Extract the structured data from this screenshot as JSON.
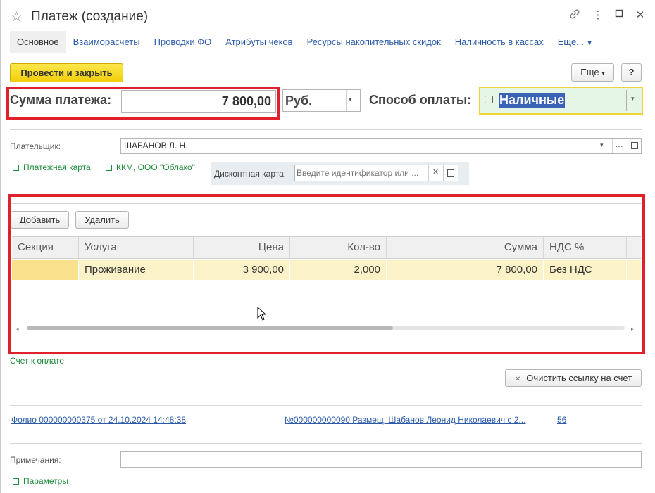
{
  "window": {
    "title": "Платеж (создание)",
    "controls": [
      "⊘",
      "⋮",
      "□",
      "✕"
    ]
  },
  "tabs": [
    {
      "label": "Основное",
      "active": true
    },
    {
      "label": "Взаиморасчеты"
    },
    {
      "label": "Проводки ФО"
    },
    {
      "label": "Атрибуты чеков"
    },
    {
      "label": "Ресурсы накопительных скидок"
    },
    {
      "label": "Наличность в кассах"
    },
    {
      "label": "Еще..."
    }
  ],
  "toolbar": {
    "post_close_label": "Провести и закрыть",
    "more_label": "Еще",
    "help_label": "?"
  },
  "payment": {
    "amount_label": "Сумма платежа:",
    "amount_value": "7 800,00",
    "currency_value": "Руб.",
    "method_label": "Способ оплаты:",
    "method_value": "Наличные"
  },
  "payer": {
    "label": "Плательщик:",
    "value": "ШАБАНОВ Л. Н."
  },
  "links": {
    "payment_card": "Платежная карта",
    "kkm": "ККМ, ООО \"Облако\"",
    "invoice": "Счет к оплате",
    "params": "Параметры"
  },
  "discount": {
    "label": "Дисконтная карта:",
    "placeholder": "Введите идентификатор или ..."
  },
  "table": {
    "add_label": "Добавить",
    "delete_label": "Удалить",
    "columns": [
      "Секция",
      "Услуга",
      "Цена",
      "Кол-во",
      "Сумма",
      "НДС %"
    ],
    "rows": [
      {
        "section": "",
        "service": "Проживание",
        "price": "3 900,00",
        "qty": "2,000",
        "sum": "7 800,00",
        "vat": "Без НДС"
      }
    ]
  },
  "invoice_clear_label": "Очистить ссылку на счет",
  "footer_links": {
    "folio": "Фолио 000000000375 от 24.10.2024 14:48:38",
    "booking": "№000000000090 Размещ. Шабанов Леонид Николаевич с 2...",
    "number": "56"
  },
  "notes": {
    "label": "Примечания:",
    "value": ""
  },
  "colors": {
    "accent_red": "#e0202a",
    "button_yellow": "#f2cf0b",
    "link_blue": "#2a5aa8",
    "link_green": "#1c8b3a",
    "row_highlight": "#fbf3c7"
  }
}
